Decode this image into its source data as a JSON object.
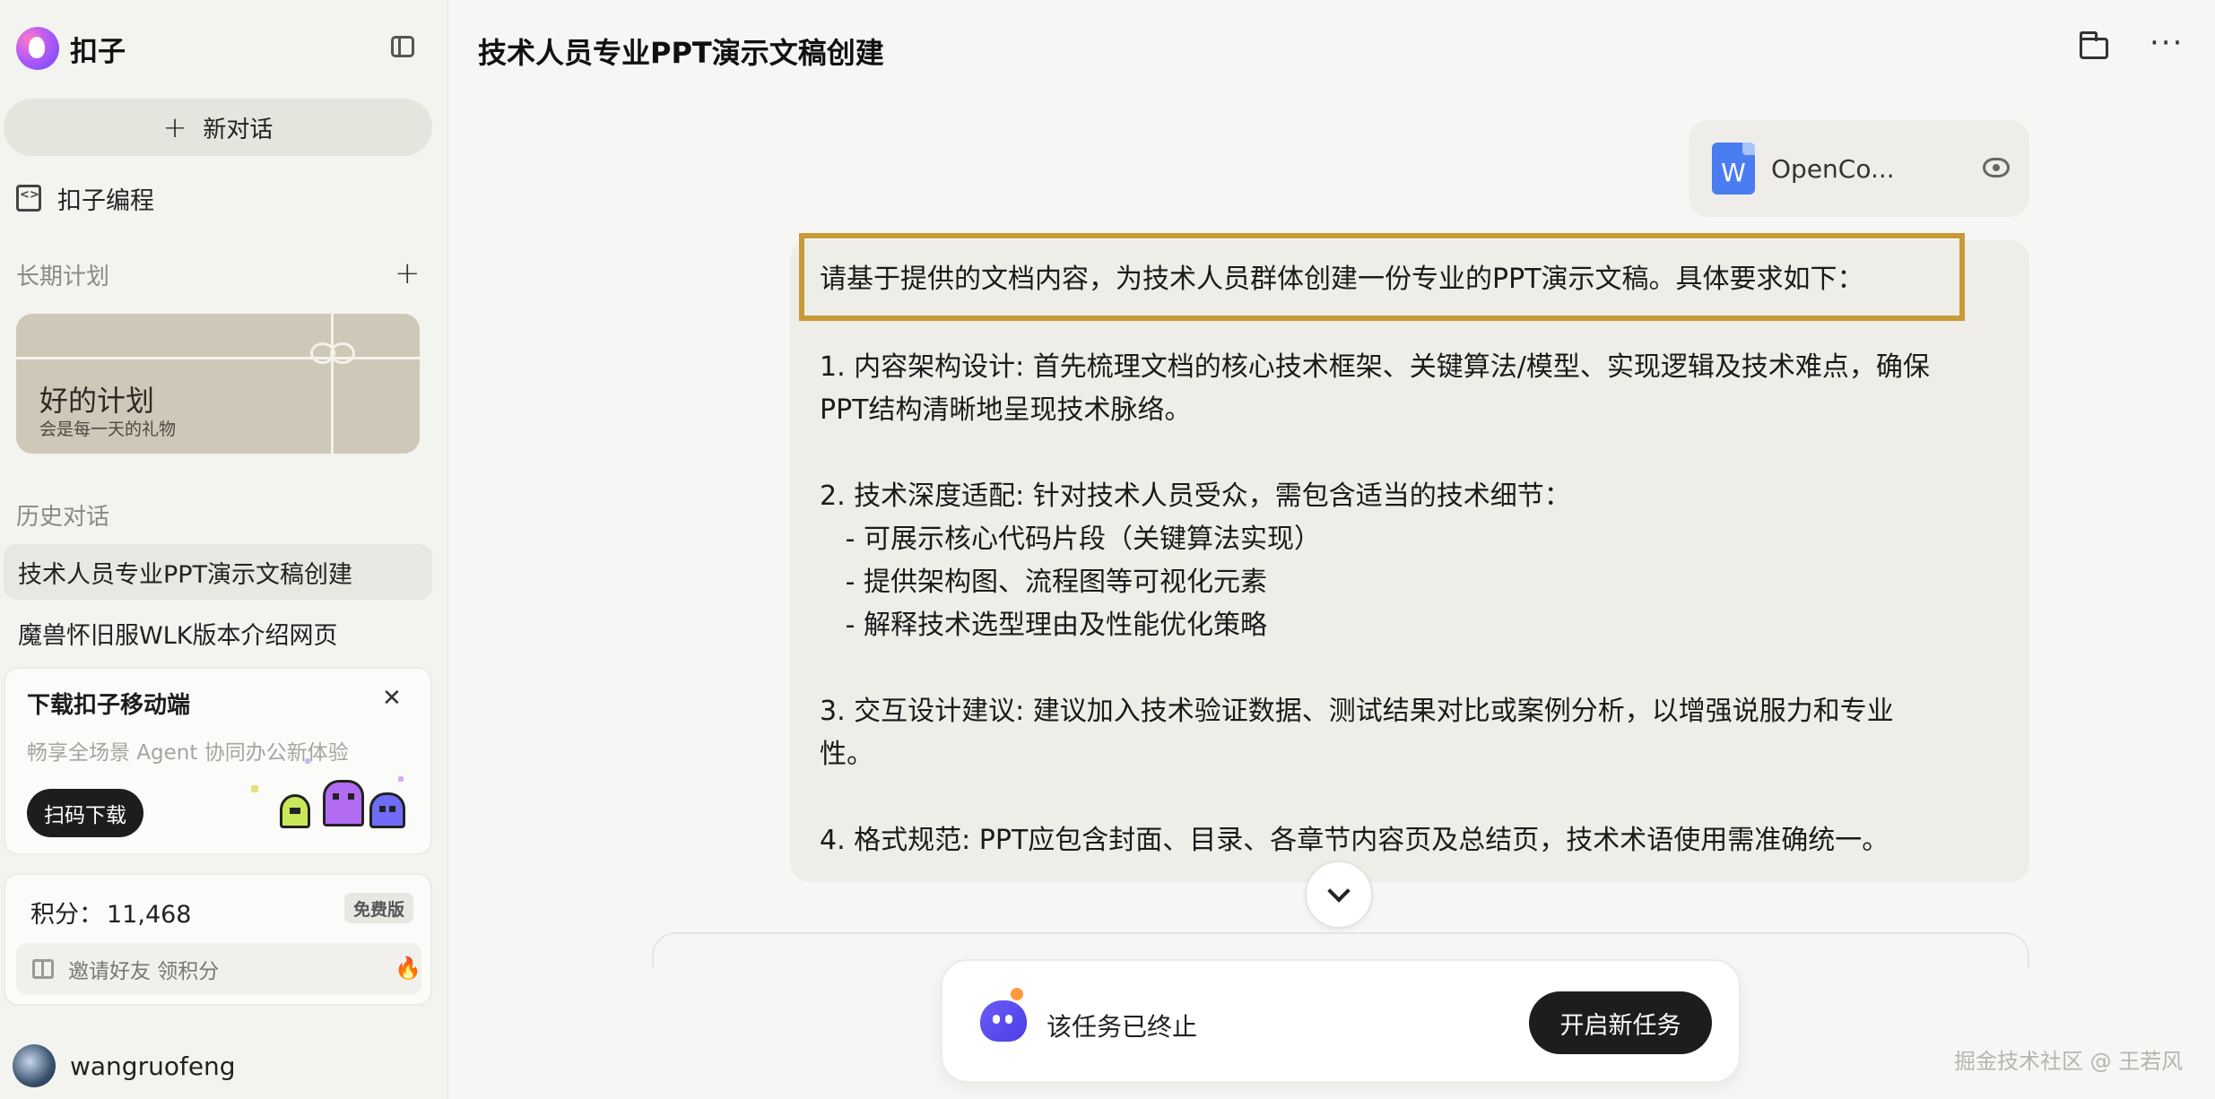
{
  "brand": {
    "name": "扣子"
  },
  "sidebar": {
    "new_chat_label": "新对话",
    "nav_code_label": "扣子编程",
    "long_term_label": "长期计划",
    "plan_card": {
      "title": "好的计划",
      "subtitle": "会是每一天的礼物"
    },
    "history_label": "历史对话",
    "history": [
      {
        "label": "技术人员专业PPT演示文稿创建",
        "active": true
      },
      {
        "label": "魔兽怀旧服WLK版本介绍网页",
        "active": false
      }
    ],
    "promo": {
      "title": "下载扣子移动端",
      "subtitle": "畅享全场景 Agent 协同办公新体验",
      "button_label": "扫码下载"
    },
    "points": {
      "label": "积分：",
      "value": "11,468",
      "badge": "免费版",
      "invite_label": "邀请好友 领积分"
    },
    "user": {
      "name": "wangruofeng"
    }
  },
  "main": {
    "title": "技术人员专业PPT演示文稿创建",
    "attachment": {
      "file_name": "OpenCo..."
    },
    "message": {
      "lines": [
        "请基于提供的文档内容，为技术人员群体创建一份专业的PPT演示文稿。具体要求如下：",
        "1. 内容架构设计: 首先梳理文档的核心技术框架、关键算法/模型、实现逻辑及技术难点，确保",
        "PPT结构清晰地呈现技术脉络。",
        "2. 技术深度适配: 针对技术人员受众，需包含适当的技术细节：",
        "   - 可展示核心代码片段（关键算法实现）",
        "   - 提供架构图、流程图等可视化元素",
        "   - 解释技术选型理由及性能优化策略",
        "3. 交互设计建议: 建议加入技术验证数据、测试结果对比或案例分析，以增强说服力和专业",
        "性。",
        "4. 格式规范: PPT应包含封面、目录、各章节内容页及总结页，技术术语使用需准确统一。"
      ]
    },
    "status": {
      "text": "该任务已终止",
      "button_label": "开启新任务"
    },
    "watermark": "掘金技术社区 @ 王若风"
  },
  "colors": {
    "accent": "#c79a35",
    "bot": "#5b4ef0",
    "button_dark": "#1d1d1d",
    "doc_blue": "#4b7df2"
  }
}
